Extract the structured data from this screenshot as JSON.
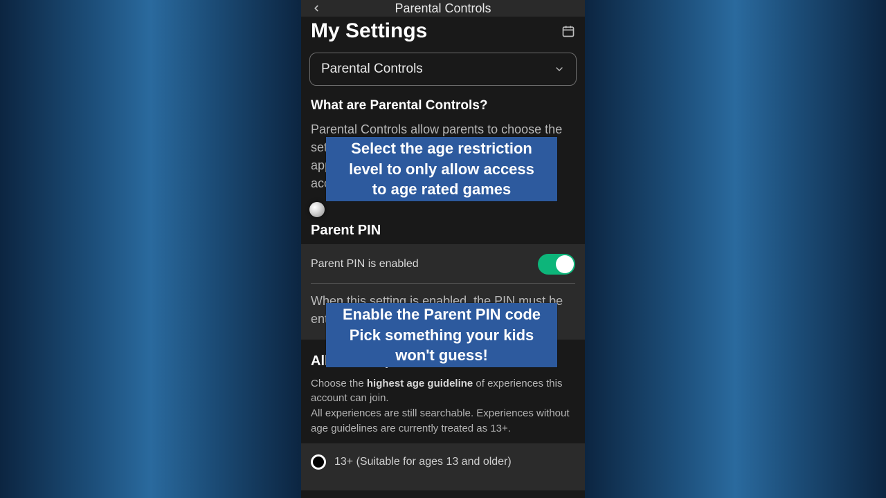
{
  "topbar": {
    "title": "Parental Controls"
  },
  "page": {
    "title": "My Settings"
  },
  "dropdown": {
    "selected": "Parental Controls"
  },
  "intro": {
    "question": "What are Parental Controls?",
    "body": "Parental Controls allow parents to choose the set of experiences that will contain content appropriate for their child can access on this account."
  },
  "parent_pin": {
    "heading": "Parent PIN",
    "toggle_label": "Parent PIN is enabled",
    "toggle_on": true,
    "desc": "When this setting is enabled, the PIN must be entered to change most settings."
  },
  "allowed": {
    "heading": "Allowed Experiences",
    "desc_prefix": "Choose the ",
    "desc_bold": "highest age guideline",
    "desc_mid": " of experiences this account can join.",
    "desc_line2": "All experiences are still searchable. Experiences without age guidelines are currently treated as 13+.",
    "option1": "13+ (Suitable for ages 13 and older)"
  },
  "captions": {
    "c1": "Select the age restriction\nlevel to only allow access\nto age rated games",
    "c2": "Enable the Parent PIN code\nPick something your kids\nwon't guess!"
  }
}
